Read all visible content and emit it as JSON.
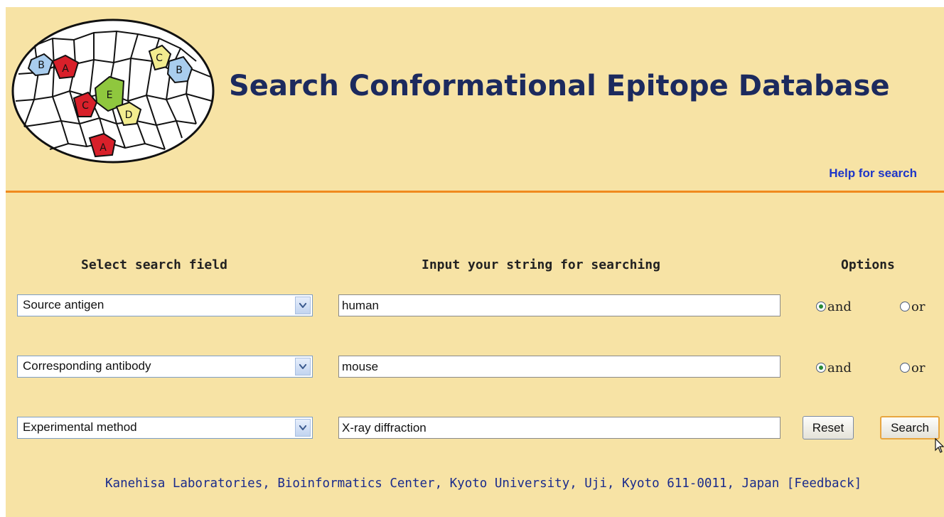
{
  "header": {
    "title": "Search Conformational Epitope Database",
    "help_link": "Help for search",
    "logo": {
      "cell_labels": [
        "B",
        "A",
        "C",
        "B",
        "E",
        "C",
        "D",
        "A"
      ],
      "colors": {
        "blue": "#a9cdee",
        "red": "#d8202a",
        "yellow": "#f2ec8f",
        "green": "#8fc73e"
      }
    }
  },
  "form": {
    "headings": {
      "field": "Select search field",
      "string": "Input your string for searching",
      "options": "Options"
    },
    "rows": [
      {
        "field": "Source antigen",
        "value": "human",
        "and_label": "and",
        "or_label": "or",
        "selected": "and"
      },
      {
        "field": "Corresponding antibody",
        "value": "mouse",
        "and_label": "and",
        "or_label": "or",
        "selected": "and"
      },
      {
        "field": "Experimental method",
        "value": "X-ray diffraction"
      }
    ],
    "buttons": {
      "reset": "Reset",
      "search": "Search"
    }
  },
  "footer": {
    "address": "Kanehisa Laboratories, Bioinformatics Center, Kyoto University, Uji, Kyoto 611-0011, Japan",
    "feedback": "[Feedback]"
  }
}
